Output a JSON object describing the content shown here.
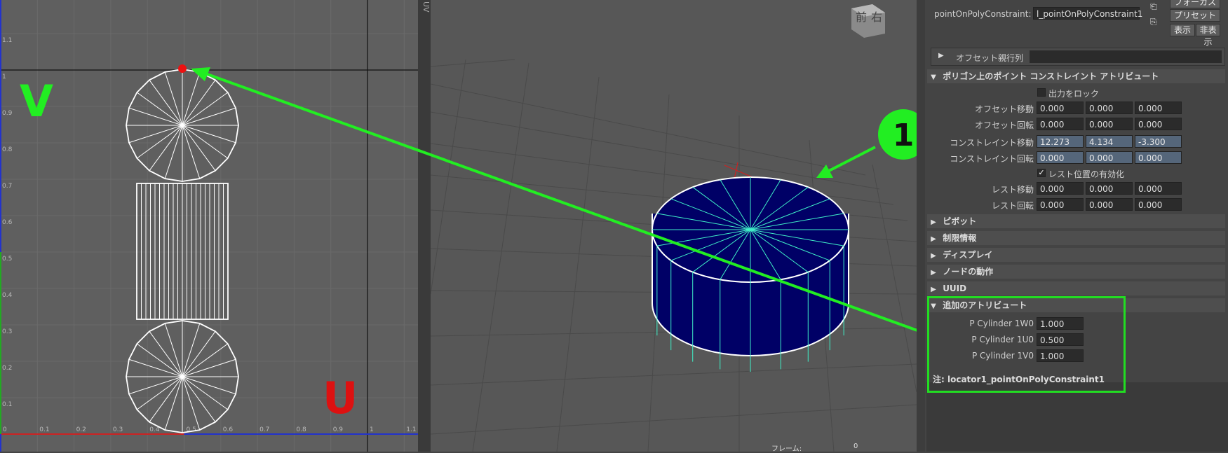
{
  "uv_editor": {
    "v_label": "V",
    "u_label": "U",
    "v_ticks": [
      "1.1",
      "1",
      "0.9",
      "0.8",
      "0.7",
      "0.6",
      "0.5",
      "0.4",
      "0.3",
      "0.2",
      "0.1"
    ],
    "u_ticks": [
      "0",
      "0.1",
      "0.2",
      "0.3",
      "0.4",
      "0.5",
      "0.6",
      "0.7",
      "0.8",
      "0.9",
      "1",
      "1.1"
    ],
    "colors": {
      "v_label": "#22ee22",
      "u_label": "#dd1111",
      "pin": "#ee1111"
    }
  },
  "divider_label": "UV",
  "viewport": {
    "view_cube_front": "前",
    "view_cube_right": "右",
    "frame_label": "フレーム:",
    "frame_value": "0",
    "annotation_number": "1",
    "colors": {
      "cylinder": "#000066",
      "edges": "#3ff0c8",
      "arrow": "#22ee22"
    }
  },
  "attribute_editor": {
    "node_label": "pointOnPolyConstraint:",
    "node_name": "l_pointOnPolyConstraint1",
    "buttons": {
      "focus": "フォーカス",
      "preset": "プリセット",
      "show": "表示",
      "hide": "非表示"
    },
    "offset_parent_matrix": "オフセット親行列",
    "main_section": "ポリゴン上のポイント コンストレイント アトリビュート",
    "lock_output": "出力をロック",
    "offset_translate": {
      "label": "オフセット移動",
      "values": [
        "0.000",
        "0.000",
        "0.000"
      ]
    },
    "offset_rotate": {
      "label": "オフセット回転",
      "values": [
        "0.000",
        "0.000",
        "0.000"
      ]
    },
    "constraint_translate": {
      "label": "コンストレイント移動",
      "values": [
        "12.273",
        "4.134",
        "-3.300"
      ]
    },
    "constraint_rotate": {
      "label": "コンストレイント回転",
      "values": [
        "0.000",
        "0.000",
        "0.000"
      ]
    },
    "rest_enable": "レスト位置の有効化",
    "rest_translate": {
      "label": "レスト移動",
      "values": [
        "0.000",
        "0.000",
        "0.000"
      ]
    },
    "rest_rotate": {
      "label": "レスト回転",
      "values": [
        "0.000",
        "0.000",
        "0.000"
      ]
    },
    "sections": [
      "ピボット",
      "制限情報",
      "ディスプレイ",
      "ノードの動作",
      "UUID"
    ],
    "extra_section": "追加のアトリビュート",
    "extra_attrs": [
      {
        "label": "P Cylinder 1W0",
        "value": "1.000"
      },
      {
        "label": "P Cylinder 1U0",
        "value": "0.500"
      },
      {
        "label": "P Cylinder 1V0",
        "value": "1.000"
      }
    ],
    "note": "注:  locator1_pointOnPolyConstraint1"
  }
}
